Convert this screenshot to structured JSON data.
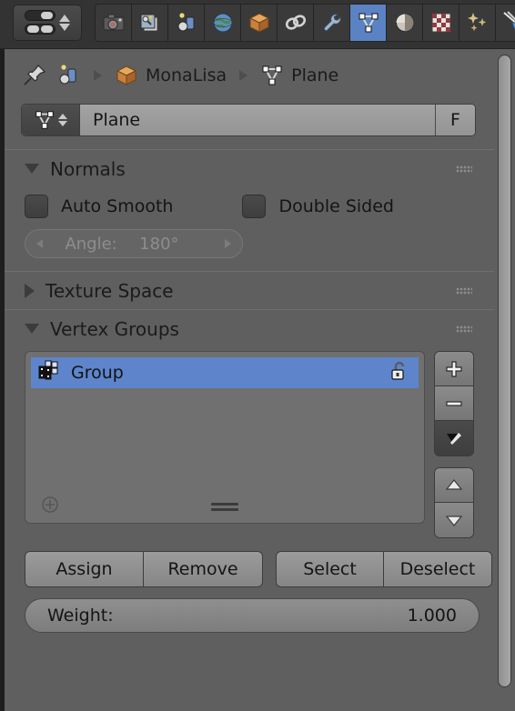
{
  "topbar": {
    "editor_selector": {
      "name": "properties-editor-selector"
    },
    "tabs": [
      {
        "id": "render",
        "icon": "camera-icon",
        "label": "Render",
        "active": false
      },
      {
        "id": "render-layers",
        "icon": "render-layers-icon",
        "label": "Render Layers",
        "active": false
      },
      {
        "id": "scene",
        "icon": "scene-icon",
        "label": "Scene",
        "active": false
      },
      {
        "id": "world",
        "icon": "world-globe-icon",
        "label": "World",
        "active": false
      },
      {
        "id": "object",
        "icon": "object-cube-icon",
        "label": "Object",
        "active": false
      },
      {
        "id": "constraints",
        "icon": "chain-link-icon",
        "label": "Constraints",
        "active": false
      },
      {
        "id": "modifiers",
        "icon": "wrench-icon",
        "label": "Modifiers",
        "active": false
      },
      {
        "id": "object-data",
        "icon": "mesh-data-triangle-icon",
        "label": "Object Data",
        "active": true
      },
      {
        "id": "material",
        "icon": "material-sphere-icon",
        "label": "Material",
        "active": false
      },
      {
        "id": "texture",
        "icon": "texture-checker-icon",
        "label": "Texture",
        "active": false
      },
      {
        "id": "particles",
        "icon": "particles-sparkle-icon",
        "label": "Particles",
        "active": false
      },
      {
        "id": "physics",
        "icon": "physics-orbit-icon",
        "label": "Physics",
        "active": false
      }
    ],
    "active_tab_color": "#5b83c4"
  },
  "breadcrumb": {
    "pin_icon": "pin-icon",
    "editor_icon": "scene-data-icon",
    "items": [
      {
        "icon": "object-cube-icon",
        "label": "MonaLisa"
      },
      {
        "icon": "mesh-data-triangle-icon",
        "label": "Plane"
      }
    ]
  },
  "name_field": {
    "icon": "mesh-data-triangle-icon",
    "value": "Plane",
    "fake_user_label": "F"
  },
  "sections": {
    "normals": {
      "title": "Normals",
      "expanded": true,
      "auto_smooth": {
        "label": "Auto Smooth",
        "checked": false
      },
      "double_sided": {
        "label": "Double Sided",
        "checked": false
      },
      "angle": {
        "label": "Angle:",
        "value": "180°",
        "enabled": false
      }
    },
    "texture_space": {
      "title": "Texture Space",
      "expanded": false
    },
    "vertex_groups": {
      "title": "Vertex Groups",
      "expanded": true,
      "list": [
        {
          "icon": "vertex-group-icon",
          "name": "Group",
          "selected": true,
          "lock_icon": "unlocked-padlock-icon"
        }
      ],
      "side_buttons": [
        {
          "id": "add",
          "icon": "plus-icon",
          "label": "Add Vertex Group"
        },
        {
          "id": "remove",
          "icon": "minus-icon",
          "label": "Remove Vertex Group"
        },
        {
          "id": "specials",
          "icon": "dropdown-triangle-icon",
          "label": "Specials"
        },
        {
          "id": "move-up",
          "icon": "triangle-up-icon",
          "label": "Move Up"
        },
        {
          "id": "move-down",
          "icon": "triangle-down-icon",
          "label": "Move Down"
        }
      ],
      "list_footer": {
        "add_icon": "circle-plus-icon",
        "grip_icon": "resize-grip-icon"
      },
      "actions": [
        {
          "id": "assign",
          "label": "Assign"
        },
        {
          "id": "remove",
          "label": "Remove"
        },
        {
          "id": "select",
          "label": "Select"
        },
        {
          "id": "deselect",
          "label": "Deselect"
        }
      ],
      "weight": {
        "label": "Weight:",
        "value": "1.000"
      }
    }
  },
  "colors": {
    "panel_bg": "#5f5f5f",
    "topbar_bg": "#333333",
    "selection_blue": "#5e85cb",
    "text": "#141414"
  }
}
